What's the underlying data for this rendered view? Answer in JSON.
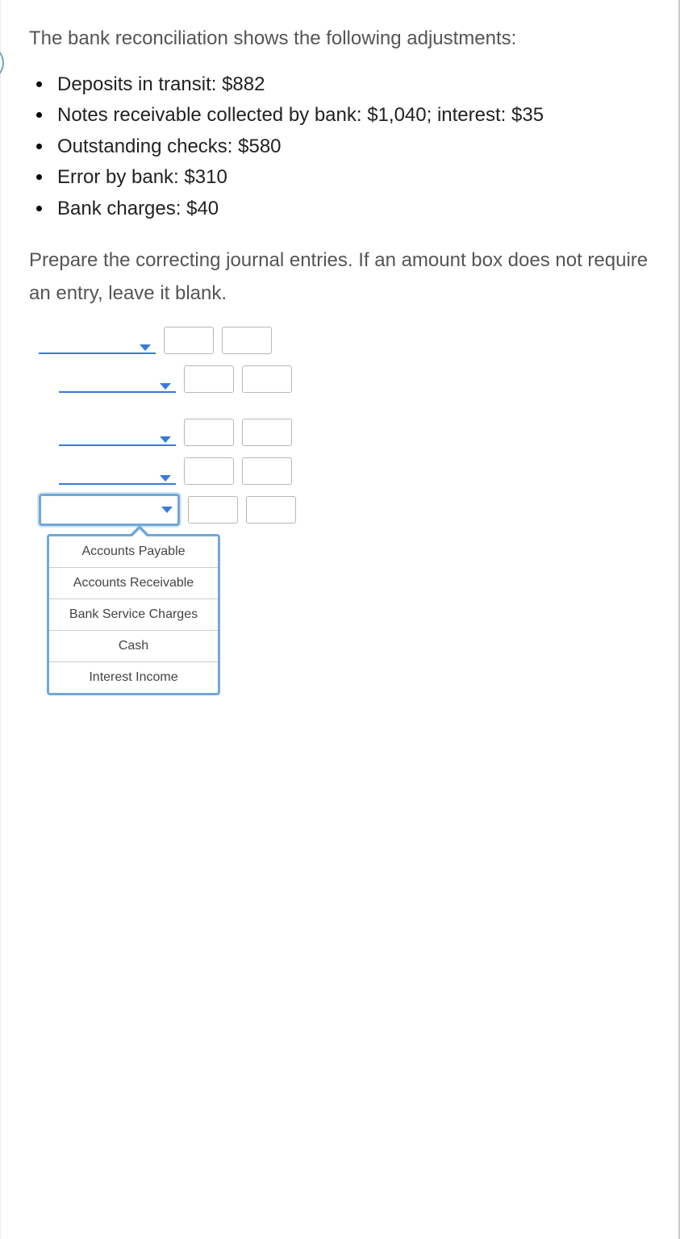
{
  "intro": "The bank reconciliation shows the following adjustments:",
  "bullets": [
    "Deposits in transit: $882",
    "Notes receivable collected by bank: $1,040; interest: $35",
    "Outstanding checks: $580",
    "Error by bank: $310",
    "Bank charges: $40"
  ],
  "instruction": "Prepare the correcting journal entries. If an amount box does not require an entry, leave it blank.",
  "dropdown_options": [
    "Accounts Payable",
    "Accounts Receivable",
    "Bank Service Charges",
    "Cash",
    "Interest Income"
  ]
}
